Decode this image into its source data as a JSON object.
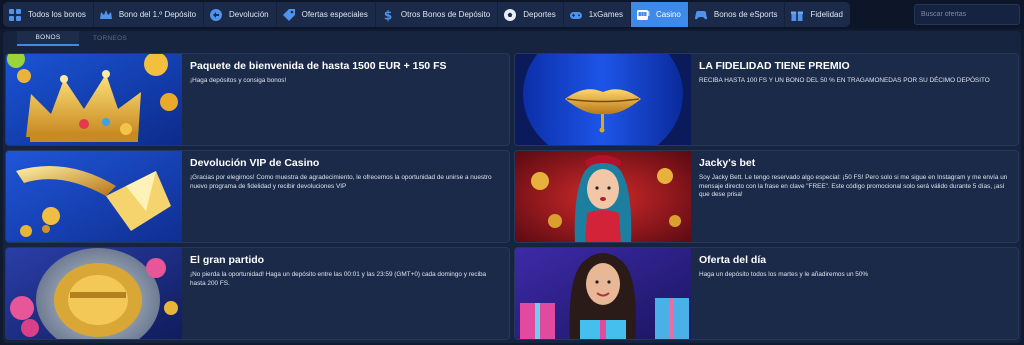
{
  "nav": {
    "items": [
      {
        "label": "Todos los bonos",
        "icon": "grid-icon"
      },
      {
        "label": "Bono del 1.º Depósito",
        "icon": "crown-icon"
      },
      {
        "label": "Devolución",
        "icon": "refund-icon"
      },
      {
        "label": "Ofertas especiales",
        "icon": "tag-icon"
      },
      {
        "label": "Otros Bonos de Depósito",
        "icon": "dollar-icon"
      },
      {
        "label": "Deportes",
        "icon": "soccer-ball-icon"
      },
      {
        "label": "1xGames",
        "icon": "gamepad-icon"
      },
      {
        "label": "Casino",
        "icon": "slot-machine-icon"
      },
      {
        "label": "Bonos de eSports",
        "icon": "esports-controller-icon"
      },
      {
        "label": "Fidelidad",
        "icon": "gift-icon"
      }
    ],
    "active": "Casino",
    "search_placeholder": "Buscar ofertas"
  },
  "tabs": [
    {
      "label": "BONOS",
      "active": true
    },
    {
      "label": "TORNEOS",
      "active": false
    }
  ],
  "cards": [
    {
      "title": "Paquete de bienvenida de hasta 1500 EUR + 150 FS",
      "desc": "¡Haga depósitos y consiga bonos!",
      "image": "golden-crown-image"
    },
    {
      "title": "LA FIDELIDAD TIENE PREMIO",
      "desc": "RECIBA HASTA 100 FS Y UN BONO DEL 50 % EN TRAGAMONEDAS POR SU DÉCIMO DEPÓSITO",
      "image": "golden-lips-image"
    },
    {
      "title": "Devolución VIP de Casino",
      "desc": "¡Gracias por elegirnos! Como muestra de agradecimiento, le ofrecemos la oportunidad de unirse a nuestro nuevo programa de fidelidad y recibir devoluciones VIP",
      "image": "golden-diamond-image"
    },
    {
      "title": "Jacky's bet",
      "desc": "Soy Jacky Bett. Le tengo reservado algo especial: ¡50 FS! Pero solo si me sigue en Instagram y me envía un mensaje directo con la frase en clave \"FREE\". Este código promocional solo será válido durante 5 días, ¡así que dese prisa!",
      "image": "jacky-portrait-image"
    },
    {
      "title": "El gran partido",
      "desc": "¡No pierda la oportunidad! Haga un depósito entre las 00:01 y las 23:59 (GMT+0) cada domingo y reciba hasta 200 FS.",
      "image": "vault-door-image"
    },
    {
      "title": "Oferta del día",
      "desc": "Haga un depósito todos los martes y le añadiremos un 50%",
      "image": "gift-woman-image"
    }
  ],
  "colors": {
    "accent": "#3f89e8",
    "background": "#101a31",
    "card": "#1b2a49"
  }
}
